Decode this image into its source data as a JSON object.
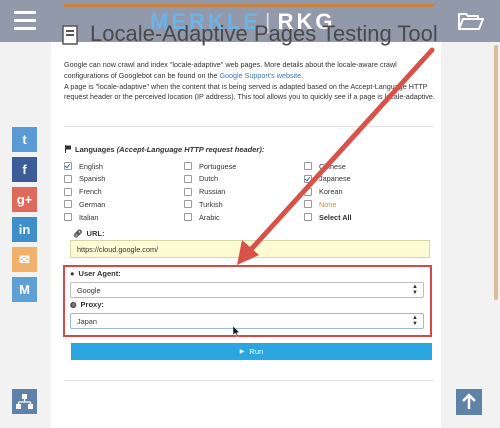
{
  "brand": {
    "left": "MERKLE",
    "right": "RKG"
  },
  "page_title": "Locale-Adaptive Pages Testing Tool",
  "intro": {
    "p1_before": "Google can now crawl and index \"locale-adaptive\" web pages. More details about the locale-aware crawl configurations of Googlebot can be found on the ",
    "p1_link": "Google Support's website",
    "p1_after": ".",
    "p2": "A page is \"locale-adaptive\" when the content that is being served is adapted based on the Accept-Language HTTP request header or the perceived location (IP address). This tool allows you to quickly see if a page is locale-adaptive."
  },
  "social": [
    {
      "name": "twitter",
      "glyph": "t",
      "color": "#5b9bd5"
    },
    {
      "name": "facebook",
      "glyph": "f",
      "color": "#3b5b99"
    },
    {
      "name": "google-plus",
      "glyph": "g+",
      "color": "#dd6a5a"
    },
    {
      "name": "linkedin",
      "glyph": "in",
      "color": "#3d8ec9"
    },
    {
      "name": "email",
      "glyph": "✉",
      "color": "#f2b16a"
    },
    {
      "name": "merkle",
      "glyph": "M",
      "color": "#5ea0d6"
    }
  ],
  "languages": {
    "heading": "Languages",
    "heading_hint": "(Accept-Language HTTP request header):",
    "items": [
      {
        "label": "English",
        "checked": true
      },
      {
        "label": "Portuguese",
        "checked": false
      },
      {
        "label": "Chinese",
        "checked": false
      },
      {
        "label": "Spanish",
        "checked": false
      },
      {
        "label": "Dutch",
        "checked": false
      },
      {
        "label": "Japanese",
        "checked": true
      },
      {
        "label": "French",
        "checked": false
      },
      {
        "label": "Russian",
        "checked": false
      },
      {
        "label": "Korean",
        "checked": false
      },
      {
        "label": "German",
        "checked": false
      },
      {
        "label": "Turkish",
        "checked": false
      },
      {
        "label": "None",
        "checked": false
      },
      {
        "label": "Italian",
        "checked": false
      },
      {
        "label": "Arabic",
        "checked": false
      },
      {
        "label": "Select All",
        "checked": false
      }
    ]
  },
  "url": {
    "label": "URL:",
    "value": "https://cloud.google.com/"
  },
  "user_agent": {
    "label": "User Agent:",
    "selected": "Google"
  },
  "proxy": {
    "label": "Proxy:",
    "selected": "Japan"
  },
  "run_label": "Run"
}
